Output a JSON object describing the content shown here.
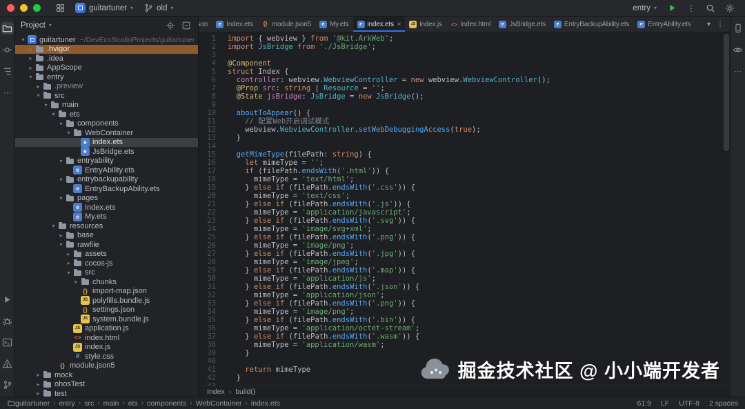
{
  "titlebar": {
    "project_name": "guitartuner",
    "branch_name": "old",
    "run_config": "entry"
  },
  "icons": {
    "chevron_down": "▾",
    "chevron_right": "▸",
    "close": "×",
    "kebab": "⋮",
    "ellipsis": "⋯",
    "separator": "›"
  },
  "project_panel": {
    "title": "Project",
    "tree": [
      {
        "label": "guitartuner",
        "hint": "~/DevEcoStudioProjects/guitartuner",
        "depth": 0,
        "icon": "project",
        "state": "open"
      },
      {
        "label": ".hvigor",
        "depth": 1,
        "icon": "folder",
        "state": "closed",
        "highlight": true
      },
      {
        "label": ".idea",
        "depth": 1,
        "icon": "folder",
        "state": "closed"
      },
      {
        "label": "AppScope",
        "depth": 1,
        "icon": "folder",
        "state": "closed"
      },
      {
        "label": "entry",
        "depth": 1,
        "icon": "folder",
        "state": "open"
      },
      {
        "label": ".preview",
        "depth": 2,
        "icon": "folder",
        "state": "closed",
        "dim": true
      },
      {
        "label": "src",
        "depth": 2,
        "icon": "folder",
        "state": "open"
      },
      {
        "label": "main",
        "depth": 3,
        "icon": "folder",
        "state": "open"
      },
      {
        "label": "ets",
        "depth": 4,
        "icon": "folder",
        "state": "open"
      },
      {
        "label": "components",
        "depth": 5,
        "icon": "folder",
        "state": "open"
      },
      {
        "label": "WebContainer",
        "depth": 6,
        "icon": "folder",
        "state": "open"
      },
      {
        "label": "index.ets",
        "depth": 7,
        "icon": "ets",
        "selected": true
      },
      {
        "label": "JsBridge.ets",
        "depth": 7,
        "icon": "ets"
      },
      {
        "label": "entryability",
        "depth": 5,
        "icon": "folder",
        "state": "open"
      },
      {
        "label": "EntryAbility.ets",
        "depth": 6,
        "icon": "ets"
      },
      {
        "label": "entrybackupability",
        "depth": 5,
        "icon": "folder",
        "state": "open"
      },
      {
        "label": "EntryBackupAbility.ets",
        "depth": 6,
        "icon": "ets"
      },
      {
        "label": "pages",
        "depth": 5,
        "icon": "folder",
        "state": "open"
      },
      {
        "label": "Index.ets",
        "depth": 6,
        "icon": "ets"
      },
      {
        "label": "My.ets",
        "depth": 6,
        "icon": "ets"
      },
      {
        "label": "resources",
        "depth": 4,
        "icon": "folder",
        "state": "open"
      },
      {
        "label": "base",
        "depth": 5,
        "icon": "folder",
        "state": "closed"
      },
      {
        "label": "rawfile",
        "depth": 5,
        "icon": "folder",
        "state": "open"
      },
      {
        "label": "assets",
        "depth": 6,
        "icon": "folder",
        "state": "closed"
      },
      {
        "label": "cocos-js",
        "depth": 6,
        "icon": "folder",
        "state": "closed"
      },
      {
        "label": "src",
        "depth": 6,
        "icon": "folder",
        "state": "open"
      },
      {
        "label": "chunks",
        "depth": 7,
        "icon": "folder",
        "state": "closed"
      },
      {
        "label": "import-map.json",
        "depth": 7,
        "icon": "json"
      },
      {
        "label": "polyfills.bundle.js",
        "depth": 7,
        "icon": "js"
      },
      {
        "label": "settings.json",
        "depth": 7,
        "icon": "json"
      },
      {
        "label": "system.bundle.js",
        "depth": 7,
        "icon": "js"
      },
      {
        "label": "application.js",
        "depth": 6,
        "icon": "js"
      },
      {
        "label": "index.html",
        "depth": 6,
        "icon": "html"
      },
      {
        "label": "index.js",
        "depth": 6,
        "icon": "js"
      },
      {
        "label": "style.css",
        "depth": 6,
        "icon": "css"
      },
      {
        "label": "module.json5",
        "depth": 4,
        "icon": "json"
      },
      {
        "label": "mock",
        "depth": 2,
        "icon": "folder",
        "state": "closed"
      },
      {
        "label": "ohosTest",
        "depth": 2,
        "icon": "folder",
        "state": "closed"
      },
      {
        "label": "test",
        "depth": 2,
        "icon": "folder",
        "state": "closed"
      }
    ]
  },
  "tabbar": {
    "tabs": [
      {
        "label": ".json",
        "type": "json",
        "clipped": true
      },
      {
        "label": "Index.ets",
        "type": "ets"
      },
      {
        "label": "module.json5",
        "type": "json"
      },
      {
        "label": "My.ets",
        "type": "ets"
      },
      {
        "label": "index.ets",
        "type": "ets",
        "active": true
      },
      {
        "label": "index.js",
        "type": "js"
      },
      {
        "label": "index.html",
        "type": "html"
      },
      {
        "label": "JsBridge.ets",
        "type": "ets"
      },
      {
        "label": "EntryBackupAbility.ets",
        "type": "ets"
      },
      {
        "label": "EntryAbility.ets",
        "type": "ets"
      }
    ]
  },
  "editor": {
    "breadcrumbs": [
      "Index",
      "build()"
    ],
    "lines": [
      [
        [
          "k",
          "import"
        ],
        [
          "n",
          " { webview } "
        ],
        [
          "k",
          "from"
        ],
        [
          "n",
          " "
        ],
        [
          "s",
          "'@kit.ArkWeb'"
        ],
        [
          "n",
          ";"
        ]
      ],
      [
        [
          "k",
          "import"
        ],
        [
          "n",
          " "
        ],
        [
          "t",
          "JsBridge"
        ],
        [
          "n",
          " "
        ],
        [
          "k",
          "from"
        ],
        [
          "n",
          " "
        ],
        [
          "s",
          "'./JsBridge'"
        ],
        [
          "n",
          ";"
        ]
      ],
      [],
      [
        [
          "d",
          "@Component"
        ]
      ],
      [
        [
          "k",
          "struct"
        ],
        [
          "n",
          " Index {"
        ]
      ],
      [
        [
          "n",
          "  "
        ],
        [
          "p",
          "controller"
        ],
        [
          "n",
          ": webview."
        ],
        [
          "t",
          "WebviewController"
        ],
        [
          "n",
          " = "
        ],
        [
          "k",
          "new"
        ],
        [
          "n",
          " webview."
        ],
        [
          "t",
          "WebviewController"
        ],
        [
          "n",
          "();"
        ]
      ],
      [
        [
          "n",
          "  "
        ],
        [
          "d",
          "@Prop"
        ],
        [
          "n",
          " "
        ],
        [
          "p",
          "src"
        ],
        [
          "n",
          ": "
        ],
        [
          "k",
          "string"
        ],
        [
          "n",
          " | "
        ],
        [
          "t",
          "Resource"
        ],
        [
          "n",
          " = "
        ],
        [
          "s",
          "''"
        ],
        [
          "n",
          ";"
        ]
      ],
      [
        [
          "n",
          "  "
        ],
        [
          "d",
          "@State"
        ],
        [
          "n",
          " "
        ],
        [
          "p",
          "jsBridge"
        ],
        [
          "n",
          ": "
        ],
        [
          "t",
          "JsBridge"
        ],
        [
          "n",
          " = "
        ],
        [
          "k",
          "new"
        ],
        [
          "n",
          " "
        ],
        [
          "t",
          "JsBridge"
        ],
        [
          "n",
          "();"
        ]
      ],
      [],
      [
        [
          "n",
          "  "
        ],
        [
          "f",
          "aboutToAppear"
        ],
        [
          "n",
          "() {"
        ]
      ],
      [
        [
          "n",
          "    "
        ],
        [
          "c",
          "// 配置Web开启调试模式"
        ]
      ],
      [
        [
          "n",
          "    webview."
        ],
        [
          "t",
          "WebviewController"
        ],
        [
          "n",
          "."
        ],
        [
          "f",
          "setWebDebuggingAccess"
        ],
        [
          "n",
          "("
        ],
        [
          "k",
          "true"
        ],
        [
          "n",
          ");"
        ]
      ],
      [
        [
          "n",
          "  }"
        ]
      ],
      [],
      [
        [
          "n",
          "  "
        ],
        [
          "f",
          "getMimeType"
        ],
        [
          "n",
          "(filePath: "
        ],
        [
          "k",
          "string"
        ],
        [
          "n",
          ") {"
        ]
      ],
      [
        [
          "n",
          "    "
        ],
        [
          "k",
          "let"
        ],
        [
          "n",
          " mimeType = "
        ],
        [
          "s",
          "''"
        ],
        [
          "n",
          ";"
        ]
      ],
      [
        [
          "n",
          "    "
        ],
        [
          "k",
          "if"
        ],
        [
          "n",
          " (filePath."
        ],
        [
          "f",
          "endsWith"
        ],
        [
          "n",
          "("
        ],
        [
          "s",
          "'.html'"
        ],
        [
          "n",
          ")) {"
        ]
      ],
      [
        [
          "n",
          "      mimeType = "
        ],
        [
          "s",
          "'text/html'"
        ],
        [
          "n",
          ";"
        ]
      ],
      [
        [
          "n",
          "    } "
        ],
        [
          "k",
          "else"
        ],
        [
          "n",
          " "
        ],
        [
          "k",
          "if"
        ],
        [
          "n",
          " (filePath."
        ],
        [
          "f",
          "endsWith"
        ],
        [
          "n",
          "("
        ],
        [
          "s",
          "'.css'"
        ],
        [
          "n",
          ")) {"
        ]
      ],
      [
        [
          "n",
          "      mimeType = "
        ],
        [
          "s",
          "'text/css'"
        ],
        [
          "n",
          ";"
        ]
      ],
      [
        [
          "n",
          "    } "
        ],
        [
          "k",
          "else"
        ],
        [
          "n",
          " "
        ],
        [
          "k",
          "if"
        ],
        [
          "n",
          " (filePath."
        ],
        [
          "f",
          "endsWith"
        ],
        [
          "n",
          "("
        ],
        [
          "s",
          "'.js'"
        ],
        [
          "n",
          ")) {"
        ]
      ],
      [
        [
          "n",
          "      mimeType = "
        ],
        [
          "s",
          "'application/javascript'"
        ],
        [
          "n",
          ";"
        ]
      ],
      [
        [
          "n",
          "    } "
        ],
        [
          "k",
          "else"
        ],
        [
          "n",
          " "
        ],
        [
          "k",
          "if"
        ],
        [
          "n",
          " (filePath."
        ],
        [
          "f",
          "endsWith"
        ],
        [
          "n",
          "("
        ],
        [
          "s",
          "'.svg'"
        ],
        [
          "n",
          ")) {"
        ]
      ],
      [
        [
          "n",
          "      mimeType = "
        ],
        [
          "s",
          "'image/svg+xml'"
        ],
        [
          "n",
          ";"
        ]
      ],
      [
        [
          "n",
          "    } "
        ],
        [
          "k",
          "else"
        ],
        [
          "n",
          " "
        ],
        [
          "k",
          "if"
        ],
        [
          "n",
          " (filePath."
        ],
        [
          "f",
          "endsWith"
        ],
        [
          "n",
          "("
        ],
        [
          "s",
          "'.png'"
        ],
        [
          "n",
          ")) {"
        ]
      ],
      [
        [
          "n",
          "      mimeType = "
        ],
        [
          "s",
          "'image/png'"
        ],
        [
          "n",
          ";"
        ]
      ],
      [
        [
          "n",
          "    } "
        ],
        [
          "k",
          "else"
        ],
        [
          "n",
          " "
        ],
        [
          "k",
          "if"
        ],
        [
          "n",
          " (filePath."
        ],
        [
          "f",
          "endsWith"
        ],
        [
          "n",
          "("
        ],
        [
          "s",
          "'.jpg'"
        ],
        [
          "n",
          ")) {"
        ]
      ],
      [
        [
          "n",
          "      mimeType = "
        ],
        [
          "s",
          "'image/jpeg'"
        ],
        [
          "n",
          ";"
        ]
      ],
      [
        [
          "n",
          "    } "
        ],
        [
          "k",
          "else"
        ],
        [
          "n",
          " "
        ],
        [
          "k",
          "if"
        ],
        [
          "n",
          " (filePath."
        ],
        [
          "f",
          "endsWith"
        ],
        [
          "n",
          "("
        ],
        [
          "s",
          "'.map'"
        ],
        [
          "n",
          ")) {"
        ]
      ],
      [
        [
          "n",
          "      mimeType = "
        ],
        [
          "s",
          "'application/js'"
        ],
        [
          "n",
          ";"
        ]
      ],
      [
        [
          "n",
          "    } "
        ],
        [
          "k",
          "else"
        ],
        [
          "n",
          " "
        ],
        [
          "k",
          "if"
        ],
        [
          "n",
          " (filePath."
        ],
        [
          "f",
          "endsWith"
        ],
        [
          "n",
          "("
        ],
        [
          "s",
          "'.json'"
        ],
        [
          "n",
          ")) {"
        ]
      ],
      [
        [
          "n",
          "      mimeType = "
        ],
        [
          "s",
          "'application/json'"
        ],
        [
          "n",
          ";"
        ]
      ],
      [
        [
          "n",
          "    } "
        ],
        [
          "k",
          "else"
        ],
        [
          "n",
          " "
        ],
        [
          "k",
          "if"
        ],
        [
          "n",
          " (filePath."
        ],
        [
          "f",
          "endsWith"
        ],
        [
          "n",
          "("
        ],
        [
          "s",
          "'.png'"
        ],
        [
          "n",
          ")) {"
        ]
      ],
      [
        [
          "n",
          "      mimeType = "
        ],
        [
          "s",
          "'image/png'"
        ],
        [
          "n",
          ";"
        ]
      ],
      [
        [
          "n",
          "    } "
        ],
        [
          "k",
          "else"
        ],
        [
          "n",
          " "
        ],
        [
          "k",
          "if"
        ],
        [
          "n",
          " (filePath."
        ],
        [
          "f",
          "endsWith"
        ],
        [
          "n",
          "("
        ],
        [
          "s",
          "'.bin'"
        ],
        [
          "n",
          ")) {"
        ]
      ],
      [
        [
          "n",
          "      mimeType = "
        ],
        [
          "s",
          "'application/octet-stream'"
        ],
        [
          "n",
          ";"
        ]
      ],
      [
        [
          "n",
          "    } "
        ],
        [
          "k",
          "else"
        ],
        [
          "n",
          " "
        ],
        [
          "k",
          "if"
        ],
        [
          "n",
          " (filePath."
        ],
        [
          "f",
          "endsWith"
        ],
        [
          "n",
          "("
        ],
        [
          "s",
          "'.wasm'"
        ],
        [
          "n",
          ")) {"
        ]
      ],
      [
        [
          "n",
          "      mimeType = "
        ],
        [
          "s",
          "'application/wasm'"
        ],
        [
          "n",
          ";"
        ]
      ],
      [
        [
          "n",
          "    }"
        ]
      ],
      [],
      [
        [
          "n",
          "    "
        ],
        [
          "k",
          "return"
        ],
        [
          "n",
          " mimeType"
        ]
      ],
      [
        [
          "n",
          "  }"
        ]
      ],
      []
    ]
  },
  "statusbar": {
    "path": [
      "guitartuner",
      "entry",
      "src",
      "main",
      "ets",
      "components",
      "WebContainer",
      "index.ets"
    ],
    "cursor_position": "61:9",
    "line_ending": "LF",
    "encoding": "UTF-8",
    "indent": "2 spaces"
  },
  "watermark": {
    "text": "掘金技术社区 @ 小小端开发者"
  }
}
